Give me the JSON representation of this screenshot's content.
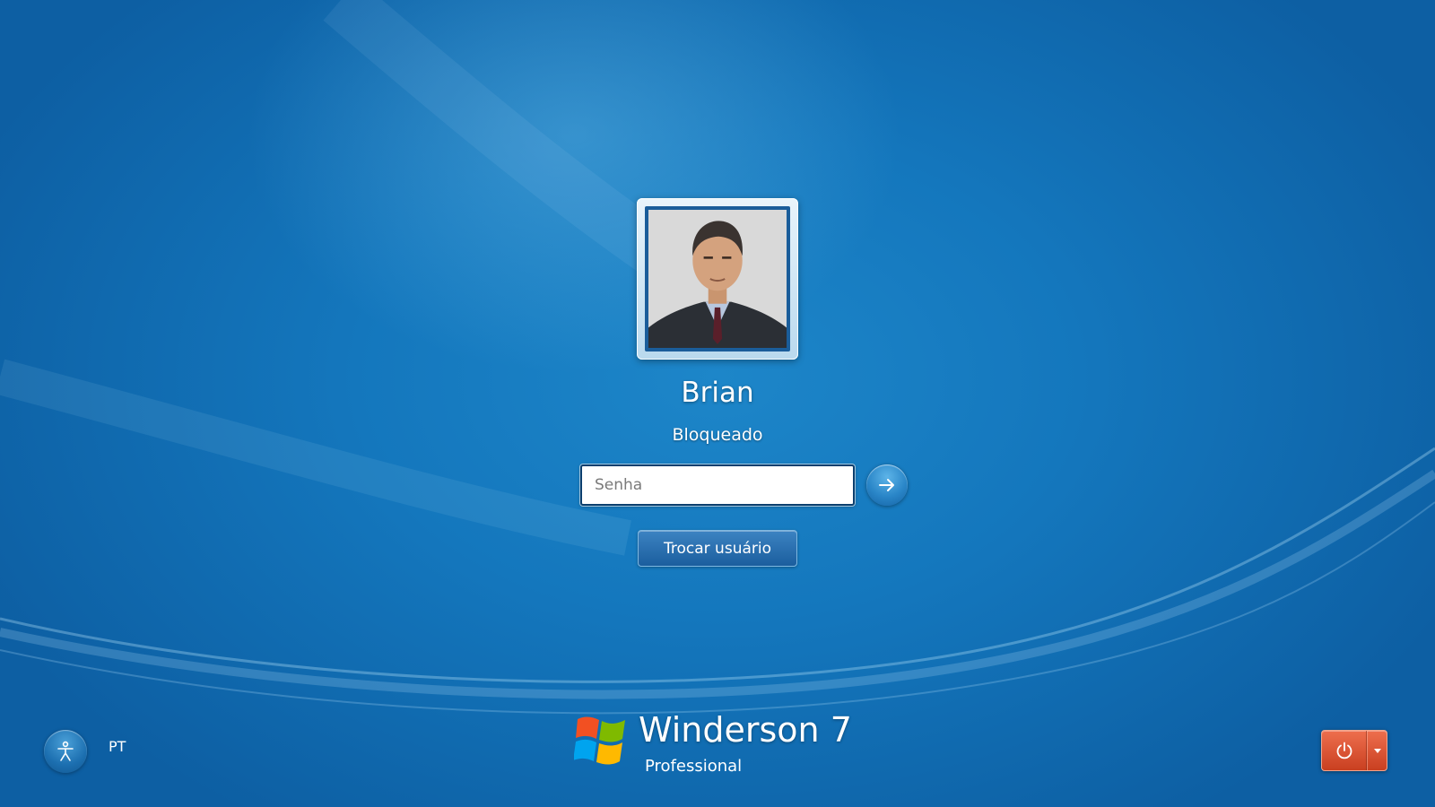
{
  "user": {
    "name": "Brian",
    "status": "Bloqueado"
  },
  "login": {
    "password_placeholder": "Senha",
    "submit_icon": "arrow-right-icon",
    "switch_user_label": "Trocar usuário"
  },
  "bottom_left": {
    "accessibility_icon": "ease-of-access-icon",
    "language": "PT"
  },
  "branding": {
    "product_name": "Winderson 7",
    "edition": "Professional",
    "logo_icon": "windows-flag-logo"
  },
  "power": {
    "power_icon": "power-icon",
    "menu_icon": "triangle-down-icon"
  },
  "colors": {
    "background": "#1477bd",
    "power_button": "#e05a38",
    "switch_button": "#2a72b2"
  }
}
